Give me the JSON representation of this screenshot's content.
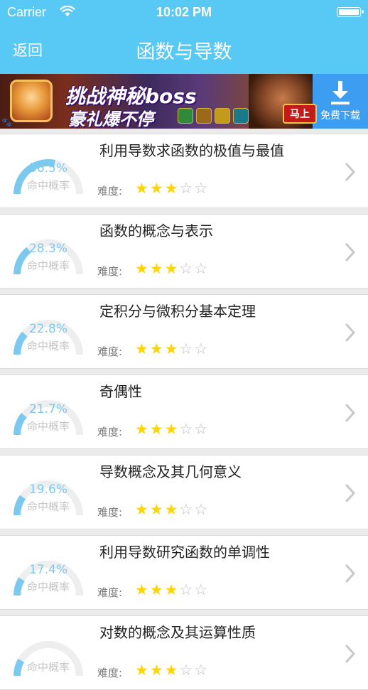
{
  "status": {
    "carrier": "Carrier",
    "time": "10:02 PM"
  },
  "nav": {
    "back_label": "返回",
    "title": "函数与导数"
  },
  "ad": {
    "line1": "挑战神秘boss",
    "line2": "豪礼爆不停",
    "cta": "马上",
    "download_label": "免费下载"
  },
  "gauge_label": "命中概率",
  "difficulty_label": "难度:",
  "colors": {
    "accent": "#58c8f5",
    "gauge_fill": "#7cc9f0",
    "gauge_track": "#eeeeee",
    "star_on": "#ffd400",
    "star_off": "#c0c0c0"
  },
  "items": [
    {
      "title": "利用导数求函数的极值与最值",
      "probability": "56.5%",
      "probability_value": 0.565,
      "stars": 3
    },
    {
      "title": "函数的概念与表示",
      "probability": "28.3%",
      "probability_value": 0.283,
      "stars": 3
    },
    {
      "title": "定积分与微积分基本定理",
      "probability": "22.8%",
      "probability_value": 0.228,
      "stars": 3
    },
    {
      "title": "奇偶性",
      "probability": "21.7%",
      "probability_value": 0.217,
      "stars": 3
    },
    {
      "title": "导数概念及其几何意义",
      "probability": "19.6%",
      "probability_value": 0.196,
      "stars": 3
    },
    {
      "title": "利用导数研究函数的单调性",
      "probability": "17.4%",
      "probability_value": 0.174,
      "stars": 3
    },
    {
      "title": "对数的概念及其运算性质",
      "probability": "",
      "probability_value": 0.163,
      "stars": 3
    }
  ]
}
